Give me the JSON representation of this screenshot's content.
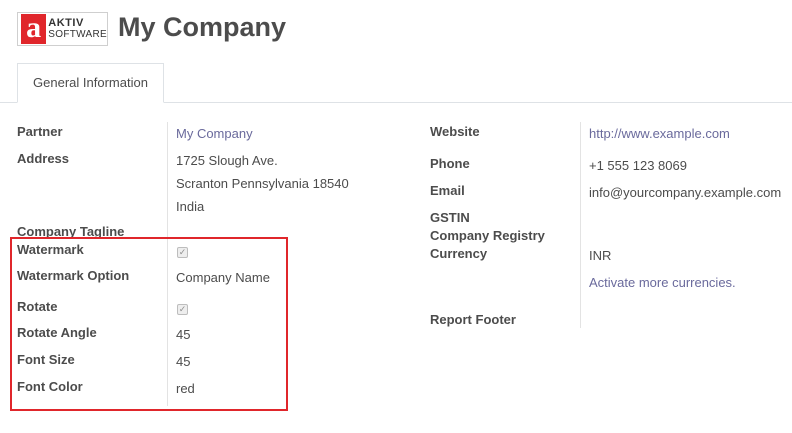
{
  "header": {
    "logo": {
      "line1": "AKTIV",
      "line2": "SOFTWARE",
      "mark": "a"
    },
    "title": "My Company"
  },
  "tabs": [
    {
      "label": "General Information"
    }
  ],
  "left": {
    "partner_label": "Partner",
    "partner_value": "My Company",
    "address_label": "Address",
    "address_lines": [
      "1725 Slough Ave.",
      "Scranton Pennsylvania 18540",
      "India"
    ],
    "tagline_label": "Company Tagline",
    "watermark_label": "Watermark",
    "watermark_checked": true,
    "watermark_option_label": "Watermark Option",
    "watermark_option_value": "Company Name",
    "rotate_label": "Rotate",
    "rotate_checked": true,
    "rotate_angle_label": "Rotate Angle",
    "rotate_angle_value": "45",
    "font_size_label": "Font Size",
    "font_size_value": "45",
    "font_color_label": "Font Color",
    "font_color_value": "red"
  },
  "right": {
    "website_label": "Website",
    "website_value": "http://www.example.com",
    "phone_label": "Phone",
    "phone_value": "+1 555 123 8069",
    "email_label": "Email",
    "email_value": "info@yourcompany.example.com",
    "gstin_label": "GSTIN",
    "registry_label": "Company Registry",
    "currency_label": "Currency",
    "currency_value": "INR",
    "currency_link": "Activate more currencies.",
    "report_footer_label": "Report Footer"
  },
  "colors": {
    "brand": "#e0262b",
    "link": "#6a6a9c",
    "highlight": "#e0262b"
  }
}
